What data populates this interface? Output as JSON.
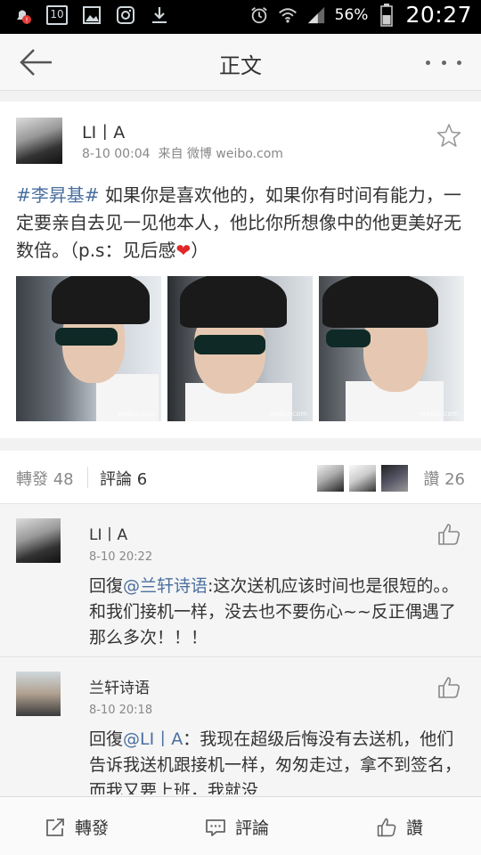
{
  "statusbar": {
    "calendar_day": "10",
    "battery": "56%",
    "time": "20:27",
    "icons": [
      "bell-alert-icon",
      "calendar-icon",
      "gallery-icon",
      "instagram-icon",
      "download-icon",
      "alarm-icon",
      "wifi-icon",
      "signal-icon",
      "battery-icon"
    ]
  },
  "header": {
    "title": "正文",
    "back_icon": "arrow-left-icon",
    "more_icon": "more-dots-icon"
  },
  "post": {
    "author": "LI丨A",
    "time": "8-10 00:04",
    "source": "来自 微博 weibo.com",
    "hashtag": "#李昇基#",
    "text": " 如果你是喜欢他的，如果你有时间有能力，一定要亲自去见一见他本人，他比你所想像中的他更美好无数倍。（p.s：见后感",
    "text_end": "）",
    "emoji": "❤",
    "favorite_icon": "star-outline-icon",
    "photo_watermark": "weibo.com"
  },
  "stats": {
    "reposts": "轉發 48",
    "comments": "評論 6",
    "likes": "讚 26"
  },
  "comments": [
    {
      "name": "LI丨A",
      "time": "8-10 20:22",
      "prefix": "回復",
      "mention": "@兰轩诗语",
      "text": ":这次送机应该时间也是很短的。。和我们接机一样，没去也不要伤心~~反正偶遇了那么多次！！！"
    },
    {
      "name": "兰轩诗语",
      "time": "8-10 20:18",
      "prefix": "回復",
      "mention": "@LI丨A",
      "text": "：我现在超级后悔没有去送机，他们告诉我送机跟接机一样，匆匆走过，拿不到签名，而我又要上班，我就没"
    }
  ],
  "bottombar": {
    "repost": "轉發",
    "comment": "評論",
    "like": "讚"
  },
  "colors": {
    "link": "#4a6fa0",
    "heart": "#e0282b"
  }
}
